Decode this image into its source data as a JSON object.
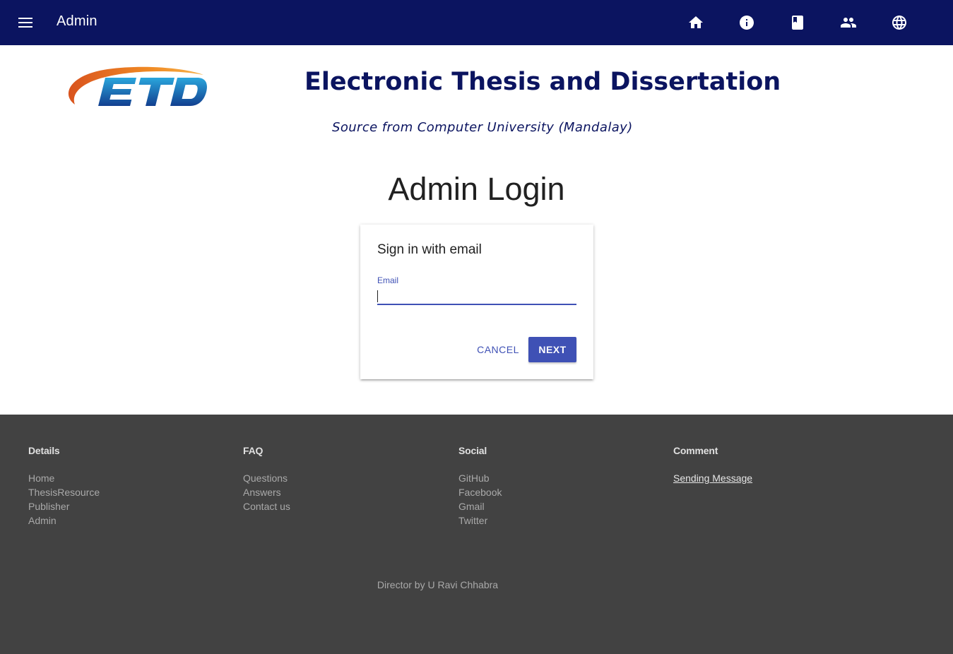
{
  "topbar": {
    "title": "Admin",
    "icons": [
      "home-icon",
      "info-icon",
      "book-icon",
      "people-icon",
      "globe-icon"
    ],
    "background": "#0b1460"
  },
  "header": {
    "logo_text": "ETD",
    "title": "Electronic Thesis and Dissertation",
    "subtitle": "Source from Computer University (Mandalay)"
  },
  "page": {
    "heading": "Admin Login"
  },
  "login_card": {
    "title": "Sign in with email",
    "email_label": "Email",
    "email_value": "",
    "cancel_label": "CANCEL",
    "next_label": "NEXT",
    "accent": "#3f51b5"
  },
  "footer": {
    "columns": [
      {
        "heading": "Details",
        "links": [
          "Home",
          "ThesisResource",
          "Publisher",
          "Admin"
        ]
      },
      {
        "heading": "FAQ",
        "links": [
          "Questions",
          "Answers",
          "Contact us"
        ]
      },
      {
        "heading": "Social",
        "links": [
          "GitHub",
          "Facebook",
          "Gmail",
          "Twitter"
        ]
      },
      {
        "heading": "Comment",
        "links": [
          "Sending Message"
        ]
      }
    ],
    "credit": "Director by U Ravi Chhabra",
    "background": "#424242"
  }
}
